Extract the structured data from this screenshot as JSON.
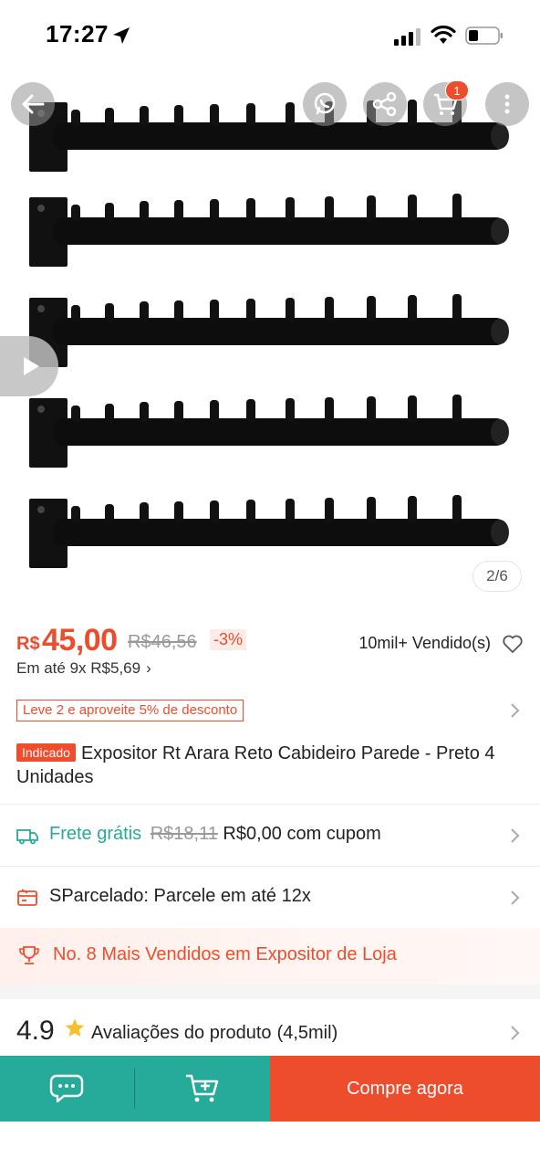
{
  "status_bar": {
    "time": "17:27"
  },
  "gallery": {
    "counter": "2/6",
    "cart_count": "1"
  },
  "price": {
    "currency": "R$",
    "current": "45,00",
    "original": "R$46,56",
    "discount": "-3%",
    "sold": "10mil+ Vendido(s)",
    "installments": "Em até 9x R$5,69"
  },
  "promo": {
    "tag": "Leve 2 e aproveite 5% de desconto"
  },
  "product": {
    "badge": "Indicado",
    "title": "Expositor Rt Arara Reto Cabideiro Parede - Preto 4 Unidades"
  },
  "shipping": {
    "label": "Frete grátis",
    "old_price": "R$18,11",
    "new_price": "R$0,00 com cupom"
  },
  "installment_row": {
    "text": "SParcelado: Parcele em até 12x"
  },
  "ranking": {
    "text": "No. 8 Mais Vendidos em Expositor de Loja"
  },
  "rating": {
    "value": "4.9",
    "label": "Avaliações do produto",
    "count": "(4,5mil)"
  },
  "bottom_bar": {
    "buy_label": "Compre agora"
  },
  "colors": {
    "brand_orange": "#ee4d2d",
    "teal": "#26aa99"
  }
}
